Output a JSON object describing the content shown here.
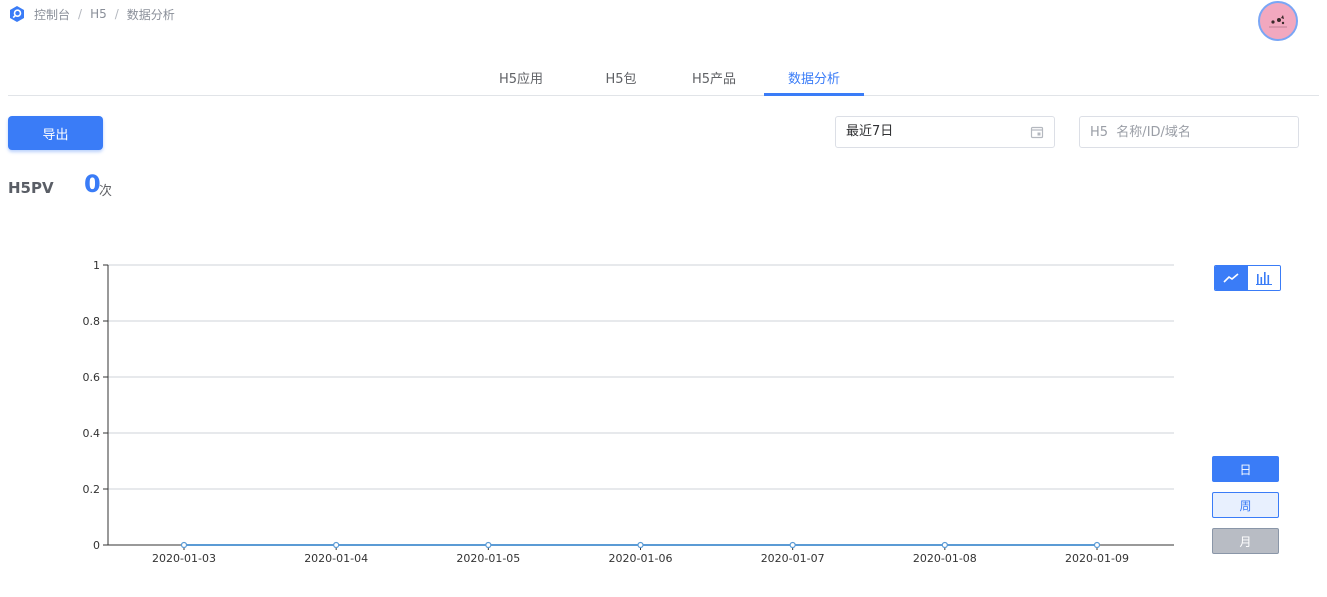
{
  "breadcrumb": {
    "items": [
      "控制台",
      "H5",
      "数据分析"
    ],
    "separator": "/"
  },
  "tabs": [
    {
      "label": "H5应用",
      "active": false
    },
    {
      "label": "H5包",
      "active": false
    },
    {
      "label": "H5产品",
      "active": false
    },
    {
      "label": "数据分析",
      "active": true
    }
  ],
  "toolbar": {
    "export_label": "导出",
    "date_range_value": "最近7日",
    "search_placeholder": "H5  名称/ID/域名"
  },
  "stat": {
    "label": "H5PV",
    "value": "0",
    "unit": "次"
  },
  "chart_controls": {
    "type_options": [
      "line-chart-icon",
      "bar-chart-icon"
    ],
    "type_selected": "line",
    "periods": [
      "日",
      "周",
      "月"
    ],
    "period_selected": "日"
  },
  "colors": {
    "accent": "#3a7cf7",
    "line": "#5b9bd5"
  },
  "chart_data": {
    "type": "line",
    "categories": [
      "2020-01-03",
      "2020-01-04",
      "2020-01-05",
      "2020-01-06",
      "2020-01-07",
      "2020-01-08",
      "2020-01-09"
    ],
    "values": [
      0,
      0,
      0,
      0,
      0,
      0,
      0
    ],
    "yticks": [
      "0",
      "0.2",
      "0.4",
      "0.6",
      "0.8",
      "1"
    ],
    "ylim": [
      0,
      1
    ],
    "grid": true
  }
}
